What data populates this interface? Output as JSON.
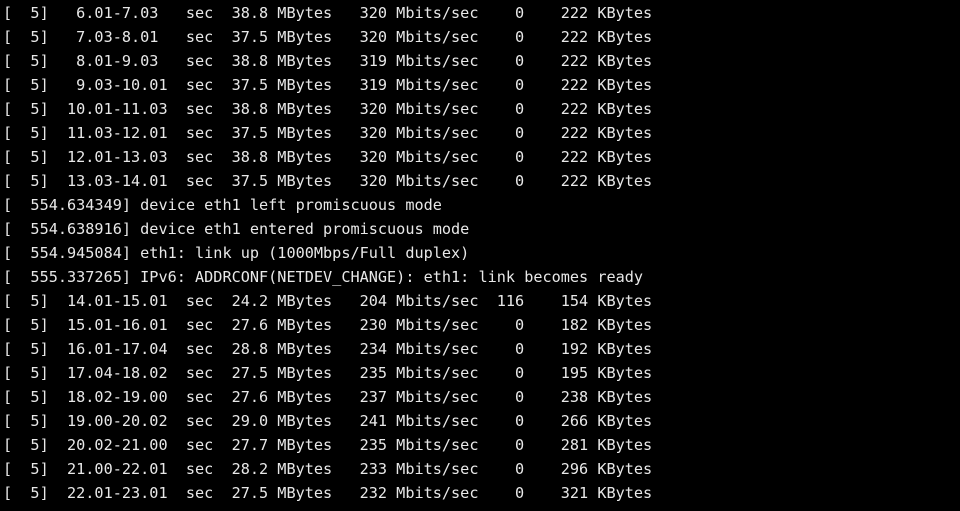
{
  "terminal": {
    "lines": [
      "[  5]   6.01-7.03   sec  38.8 MBytes   320 Mbits/sec    0    222 KBytes",
      "[  5]   7.03-8.01   sec  37.5 MBytes   320 Mbits/sec    0    222 KBytes",
      "[  5]   8.01-9.03   sec  38.8 MBytes   319 Mbits/sec    0    222 KBytes",
      "[  5]   9.03-10.01  sec  37.5 MBytes   319 Mbits/sec    0    222 KBytes",
      "[  5]  10.01-11.03  sec  38.8 MBytes   320 Mbits/sec    0    222 KBytes",
      "[  5]  11.03-12.01  sec  37.5 MBytes   320 Mbits/sec    0    222 KBytes",
      "[  5]  12.01-13.03  sec  38.8 MBytes   320 Mbits/sec    0    222 KBytes",
      "[  5]  13.03-14.01  sec  37.5 MBytes   320 Mbits/sec    0    222 KBytes",
      "[  554.634349] device eth1 left promiscuous mode",
      "[  554.638916] device eth1 entered promiscuous mode",
      "[  554.945084] eth1: link up (1000Mbps/Full duplex)",
      "[  555.337265] IPv6: ADDRCONF(NETDEV_CHANGE): eth1: link becomes ready",
      "[  5]  14.01-15.01  sec  24.2 MBytes   204 Mbits/sec  116    154 KBytes",
      "[  5]  15.01-16.01  sec  27.6 MBytes   230 Mbits/sec    0    182 KBytes",
      "[  5]  16.01-17.04  sec  28.8 MBytes   234 Mbits/sec    0    192 KBytes",
      "[  5]  17.04-18.02  sec  27.5 MBytes   235 Mbits/sec    0    195 KBytes",
      "[  5]  18.02-19.00  sec  27.6 MBytes   237 Mbits/sec    0    238 KBytes",
      "[  5]  19.00-20.02  sec  29.0 MBytes   241 Mbits/sec    0    266 KBytes",
      "[  5]  20.02-21.00  sec  27.7 MBytes   235 Mbits/sec    0    281 KBytes",
      "[  5]  21.00-22.01  sec  28.2 MBytes   233 Mbits/sec    0    296 KBytes",
      "[  5]  22.01-23.01  sec  27.5 MBytes   232 Mbits/sec    0    321 KBytes"
    ]
  },
  "colors": {
    "background": "#000000",
    "foreground": "#e8e8e8"
  }
}
